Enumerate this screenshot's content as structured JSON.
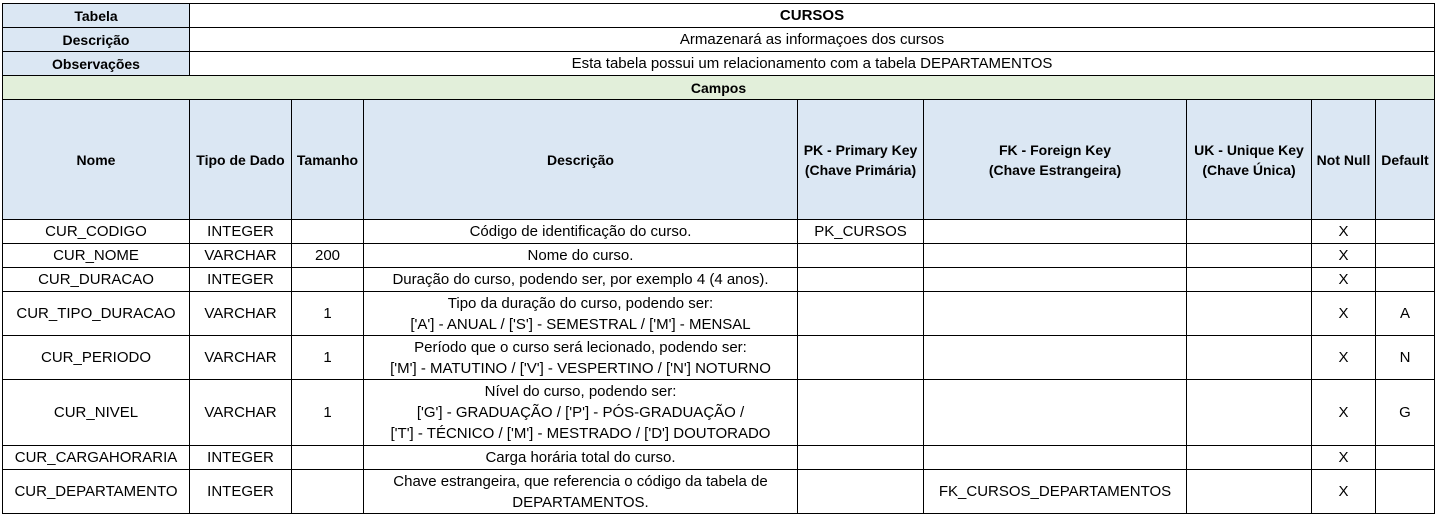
{
  "meta": {
    "tabela_label": "Tabela",
    "tabela_value": "CURSOS",
    "descricao_label": "Descrição",
    "descricao_value": "Armazenará as informaçoes dos cursos",
    "observacoes_label": "Observações",
    "observacoes_value": "Esta tabela possui um relacionamento com a tabela DEPARTAMENTOS"
  },
  "section_title": "Campos",
  "columns": {
    "nome": "Nome",
    "tipo": "Tipo de Dado",
    "tamanho": "Tamanho",
    "descricao": "Descrição",
    "pk_line1": "PK - Primary Key",
    "pk_line2": "(Chave Primária)",
    "fk_line1": "FK - Foreign Key",
    "fk_line2": "(Chave Estrangeira)",
    "uk_line1": "UK - Unique Key",
    "uk_line2": "(Chave Única)",
    "notnull": "Not Null",
    "default": "Default"
  },
  "rows": [
    {
      "nome": "CUR_CODIGO",
      "tipo": "INTEGER",
      "tamanho": "",
      "desc": [
        "Código de identificação do curso."
      ],
      "pk": "PK_CURSOS",
      "fk": "",
      "uk": "",
      "notnull": "X",
      "default": ""
    },
    {
      "nome": "CUR_NOME",
      "tipo": "VARCHAR",
      "tamanho": "200",
      "desc": [
        "Nome do curso."
      ],
      "pk": "",
      "fk": "",
      "uk": "",
      "notnull": "X",
      "default": ""
    },
    {
      "nome": "CUR_DURACAO",
      "tipo": "INTEGER",
      "tamanho": "",
      "desc": [
        "Duração do curso, podendo ser, por exemplo 4 (4 anos)."
      ],
      "pk": "",
      "fk": "",
      "uk": "",
      "notnull": "X",
      "default": ""
    },
    {
      "nome": "CUR_TIPO_DURACAO",
      "tipo": "VARCHAR",
      "tamanho": "1",
      "desc": [
        "Tipo da duração do curso, podendo ser:",
        "['A'] - ANUAL / ['S'] - SEMESTRAL / ['M'] - MENSAL"
      ],
      "pk": "",
      "fk": "",
      "uk": "",
      "notnull": "X",
      "default": "A"
    },
    {
      "nome": "CUR_PERIODO",
      "tipo": "VARCHAR",
      "tamanho": "1",
      "desc": [
        "Período que o curso será lecionado, podendo ser:",
        "['M'] - MATUTINO /  ['V'] - VESPERTINO / ['N'] NOTURNO"
      ],
      "pk": "",
      "fk": "",
      "uk": "",
      "notnull": "X",
      "default": "N"
    },
    {
      "nome": "CUR_NIVEL",
      "tipo": "VARCHAR",
      "tamanho": "1",
      "desc": [
        "Nível do curso, podendo ser:",
        "['G'] - GRADUAÇÃO /  ['P'] - PÓS-GRADUAÇÃO /",
        "['T'] - TÉCNICO / ['M'] - MESTRADO / ['D'] DOUTORADO"
      ],
      "pk": "",
      "fk": "",
      "uk": "",
      "notnull": "X",
      "default": "G"
    },
    {
      "nome": "CUR_CARGAHORARIA",
      "tipo": "INTEGER",
      "tamanho": "",
      "desc": [
        "Carga horária total do curso."
      ],
      "pk": "",
      "fk": "",
      "uk": "",
      "notnull": "X",
      "default": ""
    },
    {
      "nome": "CUR_DEPARTAMENTO",
      "tipo": "INTEGER",
      "tamanho": "",
      "desc": [
        "Chave estrangeira, que referencia o código da tabela de",
        "DEPARTAMENTOS."
      ],
      "pk": "",
      "fk": "FK_CURSOS_DEPARTAMENTOS",
      "uk": "",
      "notnull": "X",
      "default": ""
    }
  ]
}
